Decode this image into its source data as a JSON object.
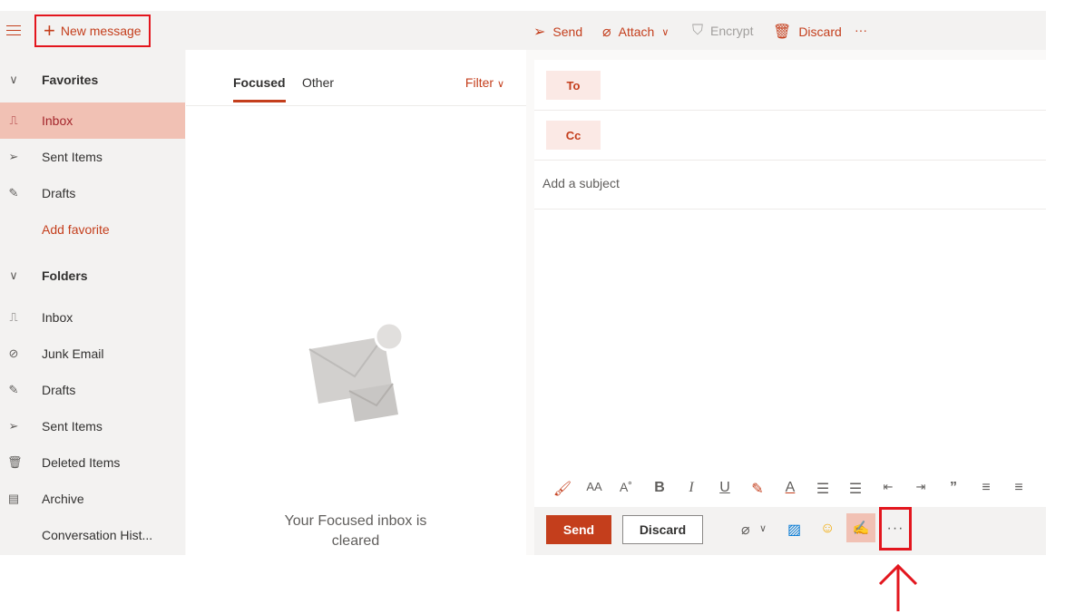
{
  "topbar": {
    "new_message": "New message",
    "send": "Send",
    "attach": "Attach",
    "encrypt": "Encrypt",
    "discard": "Discard",
    "more": "···"
  },
  "nav": {
    "favorites": "Favorites",
    "fav_items": [
      "Inbox",
      "Sent Items",
      "Drafts"
    ],
    "add_favorite": "Add favorite",
    "folders": "Folders",
    "folder_items": [
      "Inbox",
      "Junk Email",
      "Drafts",
      "Sent Items",
      "Deleted Items",
      "Archive",
      "Conversation Hist..."
    ]
  },
  "list": {
    "tab_focused": "Focused",
    "tab_other": "Other",
    "filter": "Filter",
    "empty_text": "Your Focused inbox is cleared"
  },
  "compose": {
    "to": "To",
    "cc": "Cc",
    "subject_placeholder": "Add a subject",
    "send": "Send",
    "discard": "Discard",
    "more": "···"
  },
  "colors": {
    "accent": "#c43e1c",
    "highlight_box": "#e3161e",
    "active_nav": "#f1c1b4"
  }
}
